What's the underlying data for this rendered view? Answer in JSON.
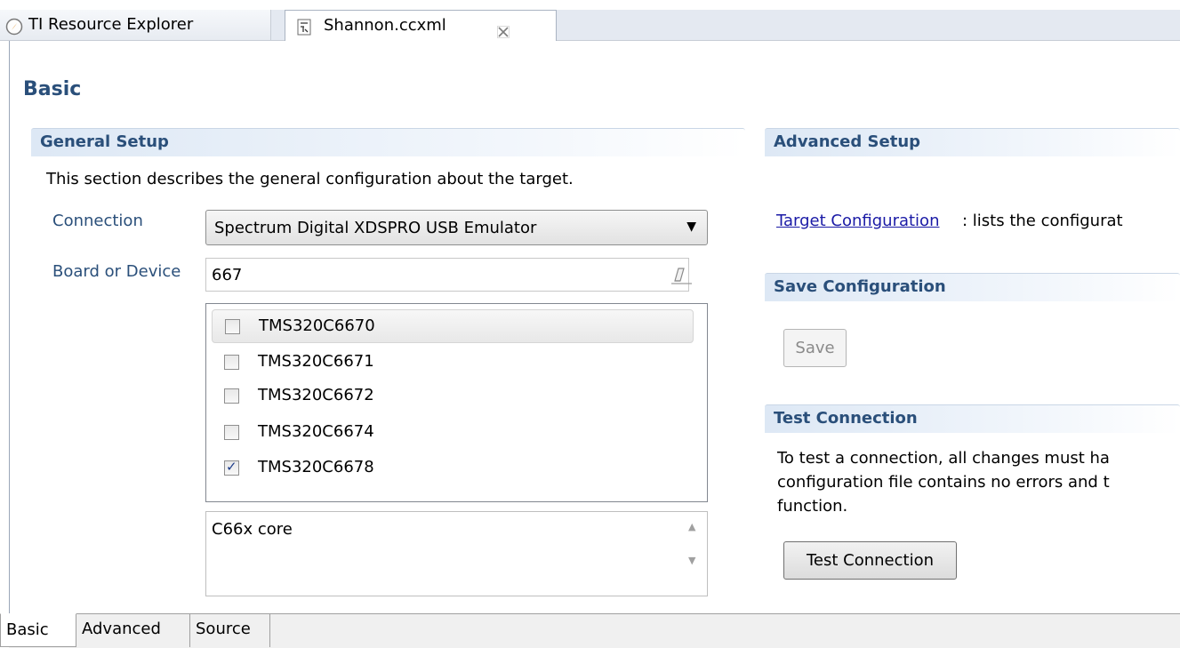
{
  "editor_tabs": [
    {
      "label": "TI Resource Explorer",
      "icon": "compass-icon"
    },
    {
      "label": "Shannon.ccxml",
      "icon": "ccxml-file-icon",
      "close_icon": "close-icon"
    }
  ],
  "page_title": "Basic",
  "general_setup": {
    "header": "General Setup",
    "description": "This section describes the general configuration about the target.",
    "connection_label": "Connection",
    "connection_value": "Spectrum Digital XDSPRO USB Emulator",
    "board_label": "Board or Device",
    "board_value": "667",
    "devices": [
      {
        "label": "TMS320C6670",
        "checked": false
      },
      {
        "label": "TMS320C6671",
        "checked": false
      },
      {
        "label": "TMS320C6672",
        "checked": false
      },
      {
        "label": "TMS320C6674",
        "checked": false
      },
      {
        "label": "TMS320C6678",
        "checked": true
      }
    ],
    "device_description": "C66x core"
  },
  "advanced_setup": {
    "header": "Advanced Setup",
    "link_text": "Target Configuration",
    "link_desc": ": lists the configurat"
  },
  "save_configuration": {
    "header": "Save Configuration",
    "button_label": "Save"
  },
  "test_connection": {
    "header": "Test Connection",
    "lines": [
      "To test a connection, all changes must ha",
      "configuration file contains no errors and t",
      "function."
    ],
    "button_label": "Test Connection"
  },
  "bottom_tabs": [
    "Basic",
    "Advanced",
    "Source"
  ],
  "colors": {
    "section_title": "#2a4f7a",
    "link": "#1a1aa6"
  }
}
